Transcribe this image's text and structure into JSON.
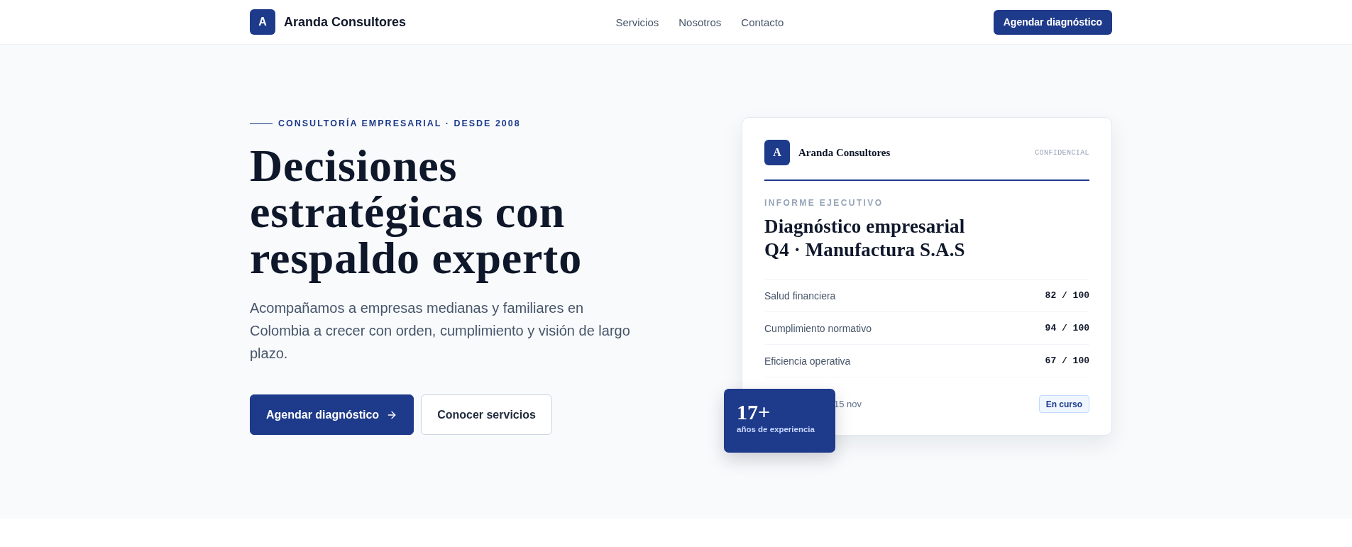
{
  "header": {
    "logo_mark": "A",
    "brand": "Aranda Consultores",
    "nav": [
      {
        "label": "Servicios"
      },
      {
        "label": "Nosotros"
      },
      {
        "label": "Contacto"
      }
    ],
    "cta": "Agendar diagnóstico"
  },
  "hero": {
    "eyebrow": "CONSULTORÍA EMPRESARIAL · DESDE 2008",
    "heading_lines": [
      "Decisiones",
      "estratégicas con",
      "respaldo experto"
    ],
    "lead_lines": [
      "Acompañamos a empresas medianas y familiares en",
      "Colombia a crecer con orden, cumplimiento y visión de largo",
      "plazo."
    ],
    "buttons": [
      {
        "label": "Agendar diagnóstico",
        "kind": "primary"
      },
      {
        "label": "Conocer servicios",
        "kind": "secondary"
      }
    ]
  },
  "report_card": {
    "logo_mark": "A",
    "brand": "Aranda Consultores",
    "tag": "CONFIDENCIAL",
    "eyebrow": "INFORME EJECUTIVO",
    "title_lines": [
      "Diagnóstico empresarial",
      "Q4 · Manufactura S.A.S"
    ],
    "metrics": [
      {
        "label": "Salud financiera",
        "score": "82 / 100"
      },
      {
        "label": "Cumplimiento normativo",
        "score": "94 / 100"
      },
      {
        "label": "Eficiencia operativa",
        "score": "67 / 100"
      }
    ],
    "date": "15 nov",
    "status": "En curso"
  },
  "experience_badge": {
    "value": "17+",
    "label": "años de experiencia"
  }
}
